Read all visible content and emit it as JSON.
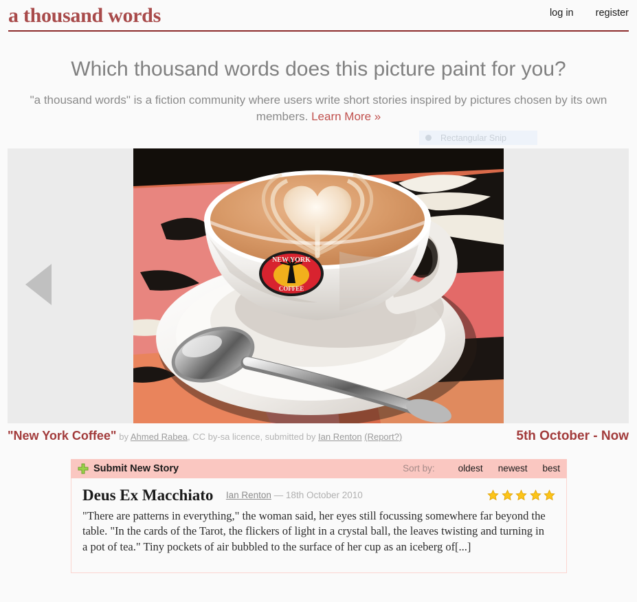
{
  "site": {
    "title": "a thousand words",
    "accent_red": "#a84a4a",
    "rule_color": "#8c2b2b"
  },
  "topnav": {
    "login_label": "log in",
    "register_label": "register"
  },
  "intro": {
    "tagline": "Which thousand words does this picture paint for you?",
    "blurb_text": "\"a thousand words\" is a fiction community where users write short stories inspired by pictures chosen by its own members.",
    "learn_more_label": "Learn More »"
  },
  "snip_overlay": {
    "label": "Rectangular Snip"
  },
  "picture": {
    "prev_arrow_name": "previous image",
    "alt": "Cappuccino with heart latte art in a New York Coffee cup on a white saucer with a spoon"
  },
  "caption": {
    "title": "\"New York Coffee\"",
    "by_word": "by",
    "photographer": "Ahmed Rabea",
    "licence": ", CC by-sa licence, submitted by ",
    "submitter": "Ian Renton",
    "report_label": "(Report?)",
    "date_range": "5th October - Now"
  },
  "stories_panel": {
    "submit_label": "Submit New Story",
    "plus_icon": "plus-icon",
    "sort_label": "Sort by:",
    "sort_options": [
      {
        "label": "oldest"
      },
      {
        "label": "newest"
      },
      {
        "label": "best"
      }
    ]
  },
  "story": {
    "title": "Deus Ex Macchiato",
    "author": "Ian Renton",
    "dash": "—",
    "date": "18th October 2010",
    "rating": 5,
    "excerpt": "\"There are patterns in everything,\" the woman said, her eyes still focussing somewhere far beyond the table. \"In the cards of the Tarot, the flickers of light in a crystal ball, the leaves twisting and turning in a pot of tea.\" Tiny pockets of air bubbled to the surface of her cup as an iceberg of[...]"
  }
}
